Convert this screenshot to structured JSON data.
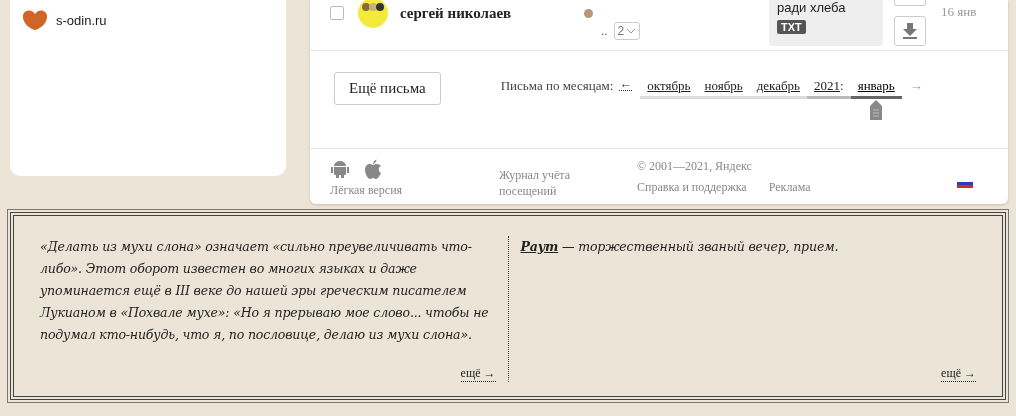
{
  "sidebar": {
    "links": [
      {
        "label": "s-odin.ru"
      }
    ]
  },
  "message": {
    "checked": false,
    "sender": "сергей николаев",
    "unread": true,
    "ellipsis": "..",
    "thread_count": "2",
    "attachment": {
      "name": "ради хлеба",
      "type": "TXT"
    },
    "date": "16 янв"
  },
  "more_button": "Ещё письма",
  "months_nav": {
    "label": "Письма по месяцам:",
    "prev": "←",
    "next": "→",
    "items": [
      {
        "label": "октябрь",
        "kind": "month",
        "selected": false
      },
      {
        "label": "ноябрь",
        "kind": "month",
        "selected": false
      },
      {
        "label": "декабрь",
        "kind": "month",
        "selected": false
      },
      {
        "label": "2021",
        "kind": "year",
        "selected": false
      },
      {
        "label": "январь",
        "kind": "month",
        "selected": true
      }
    ],
    "year_sep": ":"
  },
  "footer": {
    "light_version": "Лёгкая версия",
    "visit_log": "Журнал учёта посещений",
    "copyright": "© 2001—2021, Яндекс",
    "help": "Справка и поддержка",
    "ads": "Реклама"
  },
  "facts": [
    {
      "text": "«Делать из мухи слона» означает «сильно преувеличивать что-либо». Этот оборот известен во многих языках и даже упоминается ещё в III веке до нашей эры греческим писателем Лукианом в «Похвале мухе»: «Но я прерываю мое слово... чтобы не подумал кто-нибудь, что я, по пословице, делаю из мухи слона».",
      "more": "ещё →"
    },
    {
      "text": "**Раут** — торжественный званый вечер, прием.",
      "more": "ещё →"
    }
  ]
}
